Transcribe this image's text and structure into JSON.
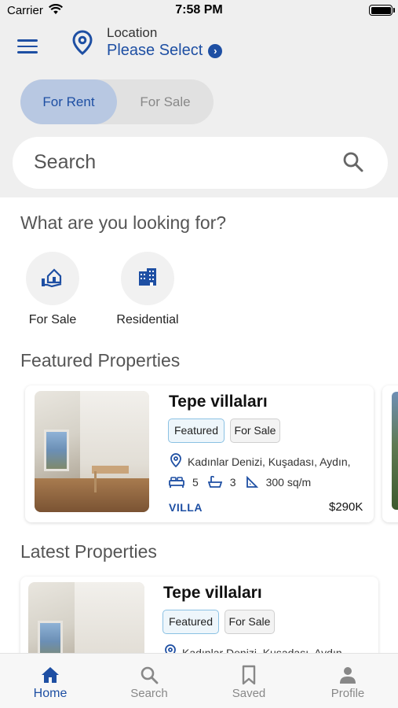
{
  "status_bar": {
    "carrier": "Carrier",
    "time": "7:58 PM"
  },
  "header": {
    "location_label": "Location",
    "location_value": "Please Select",
    "toggle": {
      "rent": "For Rent",
      "sale": "For Sale",
      "selected": "For Rent"
    },
    "search_placeholder": "Search"
  },
  "categories_section": {
    "title": "What are you looking for?",
    "items": [
      {
        "label": "For Sale",
        "icon": "hand-house-icon"
      },
      {
        "label": "Residential",
        "icon": "building-icon"
      }
    ]
  },
  "featured_section": {
    "title": "Featured Properties",
    "card": {
      "title": "Tepe villaları",
      "tags": [
        "Featured",
        "For Sale"
      ],
      "address": "Kadınlar Denizi, Kuşadası, Aydın,",
      "beds": "5",
      "baths": "3",
      "area": "300 sq/m",
      "type": "VILLA",
      "price": "$290K"
    }
  },
  "latest_section": {
    "title": "Latest Properties",
    "card": {
      "title": "Tepe villaları",
      "tags": [
        "Featured",
        "For Sale"
      ],
      "address": "Kadınlar Denizi, Kuşadası, Aydın,"
    }
  },
  "tab_bar": {
    "items": [
      {
        "label": "Home",
        "icon": "home-icon",
        "active": true
      },
      {
        "label": "Search",
        "icon": "search-icon",
        "active": false
      },
      {
        "label": "Saved",
        "icon": "bookmark-icon",
        "active": false
      },
      {
        "label": "Profile",
        "icon": "person-icon",
        "active": false
      }
    ]
  },
  "colors": {
    "accent": "#1e4fa3",
    "header_bg": "#efefef",
    "toggle_selected": "#b8c8e2",
    "featured_tag_border": "#8bc1e3"
  }
}
